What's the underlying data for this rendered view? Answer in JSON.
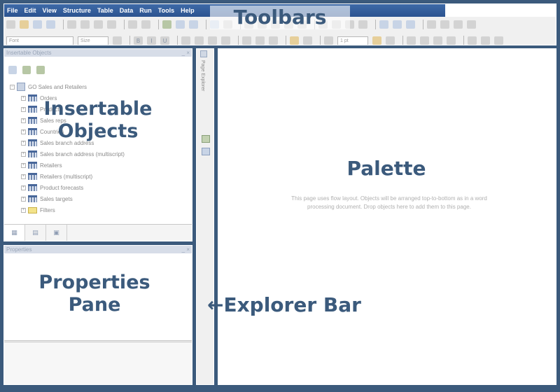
{
  "menubar": {
    "items": [
      "File",
      "Edit",
      "View",
      "Structure",
      "Table",
      "Data",
      "Run",
      "Tools",
      "Help"
    ]
  },
  "toolbar": {
    "font_placeholder": "Font",
    "size_placeholder": "Size",
    "border_width": "1 pt"
  },
  "insertable_objects": {
    "title": "Insertable Objects",
    "package": "GO Sales and Retailers",
    "items": [
      "Orders",
      "Products",
      "Sales reps",
      "Countries",
      "Sales branch address",
      "Sales branch address (multiscript)",
      "Retailers",
      "Retailers (multiscript)",
      "Product forecasts",
      "Sales targets",
      "Filters"
    ]
  },
  "properties": {
    "title": "Properties"
  },
  "explorer_bar": {
    "label": "Page Explorer"
  },
  "palette": {
    "message": "This page uses flow layout. Objects will be arranged top-to-bottom as in a word processing document. Drop objects here to add them to this page."
  },
  "annotations": {
    "toolbars": "Toolbars",
    "insertable_line1": "Insertable",
    "insertable_line2": "Objects",
    "palette": "Palette",
    "properties_line1": "Properties",
    "properties_line2": "Pane",
    "explorer": "Explorer Bar"
  },
  "colors": {
    "frame": "#3b5a7c",
    "menubar": "#2c5390",
    "annotation": "#3b5a7c"
  }
}
